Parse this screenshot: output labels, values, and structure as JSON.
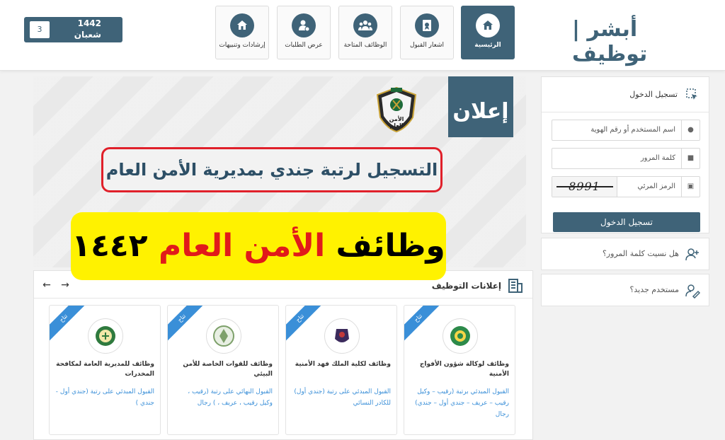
{
  "header": {
    "date": {
      "day": "3",
      "year": "1442",
      "month": "شعبان"
    },
    "logo_text": "أبشر | توظيف",
    "nav": [
      {
        "label": "الرئيسية",
        "icon": "home-icon",
        "active": true
      },
      {
        "label": "اشعار القبول",
        "icon": "document-badge-icon",
        "active": false
      },
      {
        "label": "الوظائف المتاحة",
        "icon": "group-icon",
        "active": false
      },
      {
        "label": "عرض الطلبات",
        "icon": "user-settings-icon",
        "active": false
      },
      {
        "label": "إرشادات وتنبيهات",
        "icon": "home-icon",
        "active": false
      }
    ]
  },
  "banner": {
    "tag": "إعلان",
    "emblem_text": "الأمن العام",
    "headline": "التسجيل لرتبة جندي بمديرية الأمن العام",
    "overlay": {
      "part1": "وظائف",
      "part2": "الأمن العام",
      "part3": "١٤٤٢"
    }
  },
  "jobs": {
    "title": "إعلانات التوظيف",
    "cards": [
      {
        "ribbon": "تتاح",
        "title": "وظائف لوكالة شؤون الأفواج الأمنية",
        "desc": "القبول المبدئي برتبة (رقيب – وكيل رقيب – عريف – جندي أول – جندي) رجال"
      },
      {
        "ribbon": "تتاح",
        "title": "وظائف لكلية الملك فهد الأمنية",
        "desc": "القبول المبدئي على رتبة (جندي أول) للكادر النسائي"
      },
      {
        "ribbon": "تتاح",
        "title": "وظائف للقوات الخاصة للأمن البيئي",
        "desc": "القبول النهائي على رتبة (رقيب ، وكيل رقيب ، عريف ، ) رجال"
      },
      {
        "ribbon": "تتاح",
        "title": "وظائف للمديرية العامة لمكافحة المخدرات",
        "desc": "القبول المبدئي على رتبة (جندي أول - جندي )"
      }
    ]
  },
  "login": {
    "title": "تسجيل الدخول",
    "username_placeholder": "اسم المستخدم أو رقم الهوية",
    "password_placeholder": "كلمة المرور",
    "captcha_label": "الرمز المرئي",
    "captcha_value": "8991",
    "submit_label": "تسجيل الدخول",
    "forgot_password": "هل نسيت كلمة المرور؟",
    "new_user": "مستخدم جديد؟"
  },
  "colors": {
    "primary": "#3f6378",
    "accent_red": "#e0202a",
    "highlight_yellow": "#fff200",
    "link_blue": "#3a8fd8"
  }
}
